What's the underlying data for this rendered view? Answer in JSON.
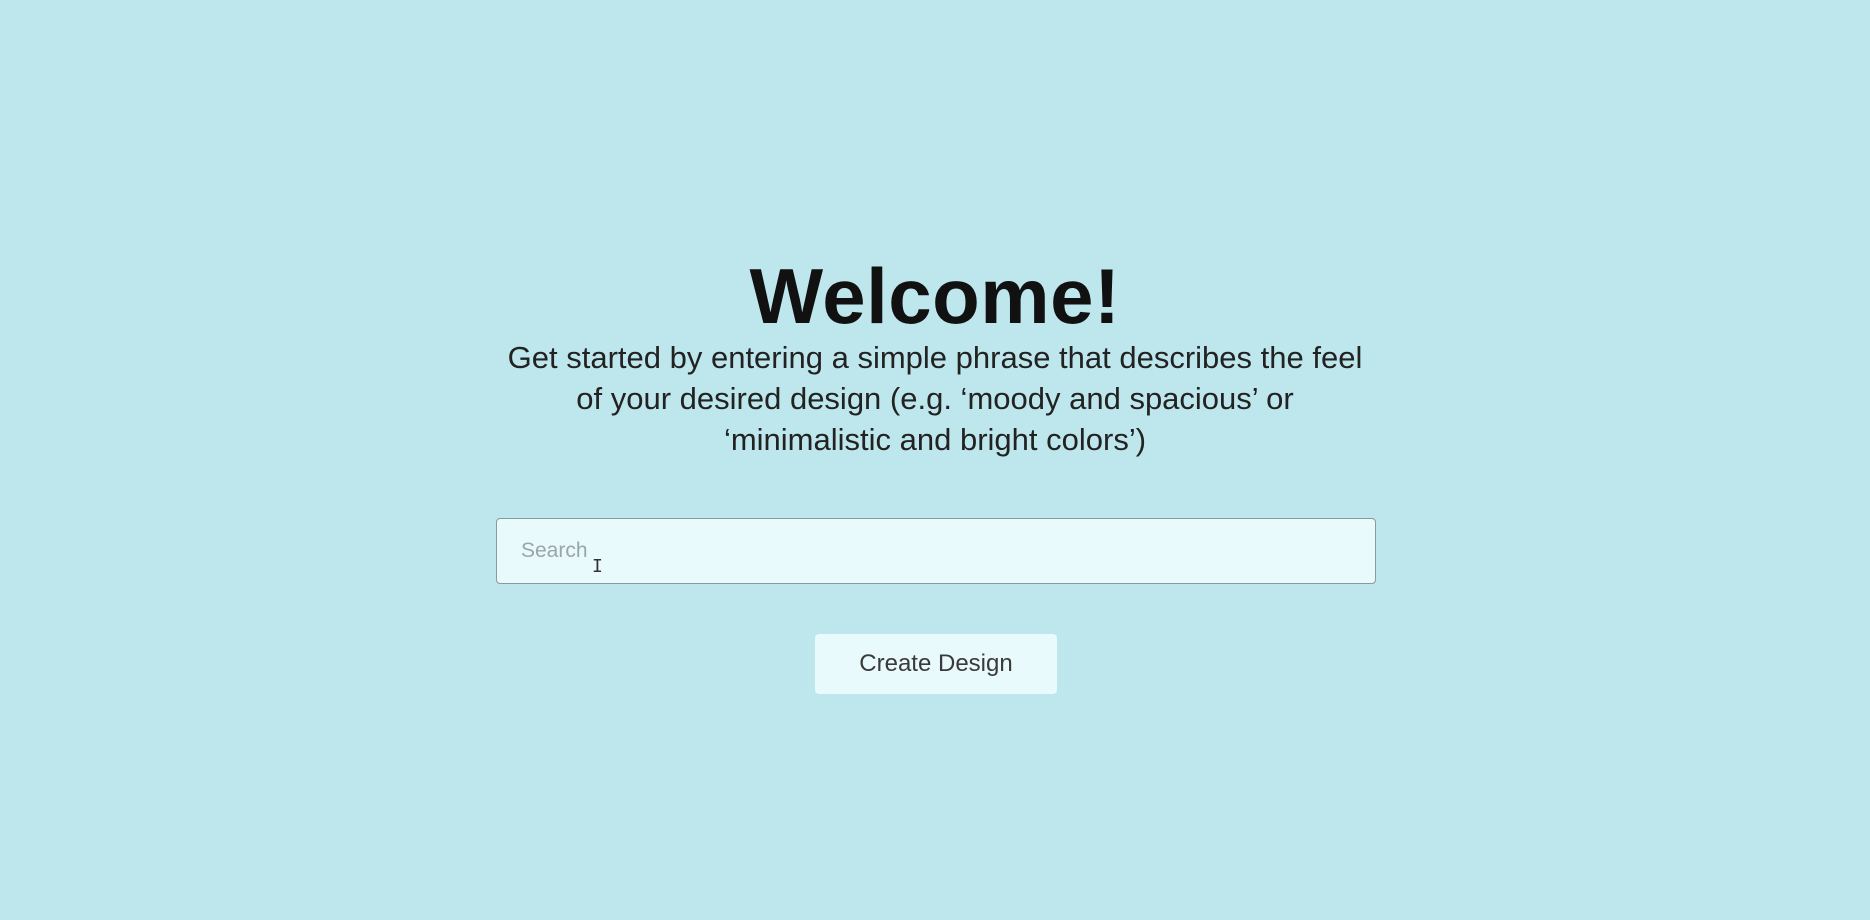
{
  "main": {
    "title": "Welcome!",
    "description_line1": "Get started by entering a simple phrase that describes the feel",
    "description_line2": "of your desired design (e.g. ‘moody and spacious’ or",
    "description_line3": "‘minimalistic and bright colors’)",
    "search": {
      "placeholder": "Search",
      "value": ""
    },
    "create_button_label": "Create Design"
  },
  "icons": {
    "text_cursor": "I-beam-cursor-icon"
  },
  "colors": {
    "background": "#bde7ec",
    "input_background": "#e8fafc",
    "button_background": "#e8fafc",
    "title": "#111111"
  }
}
